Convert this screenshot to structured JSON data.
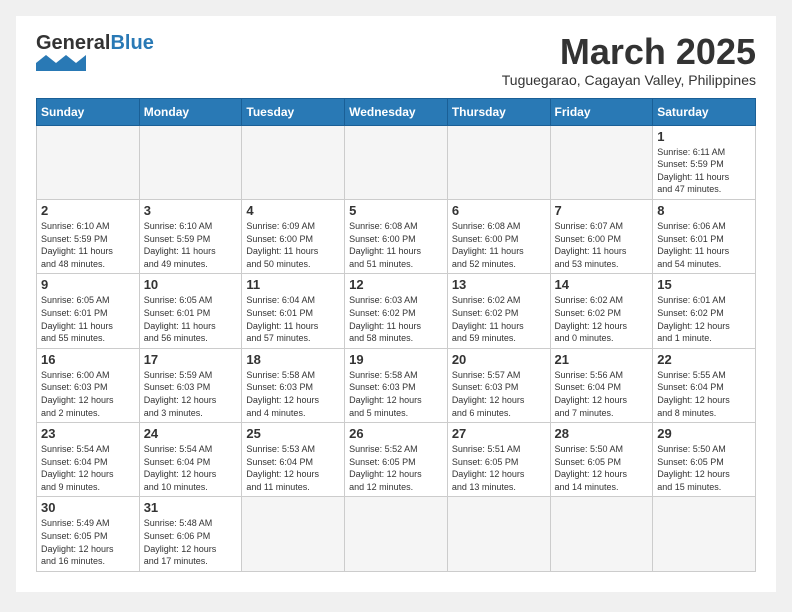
{
  "header": {
    "logo_general": "General",
    "logo_blue": "Blue",
    "month_title": "March 2025",
    "location": "Tuguegarao, Cagayan Valley, Philippines"
  },
  "weekdays": [
    "Sunday",
    "Monday",
    "Tuesday",
    "Wednesday",
    "Thursday",
    "Friday",
    "Saturday"
  ],
  "weeks": [
    [
      {
        "day": "",
        "info": ""
      },
      {
        "day": "",
        "info": ""
      },
      {
        "day": "",
        "info": ""
      },
      {
        "day": "",
        "info": ""
      },
      {
        "day": "",
        "info": ""
      },
      {
        "day": "",
        "info": ""
      },
      {
        "day": "1",
        "info": "Sunrise: 6:11 AM\nSunset: 5:59 PM\nDaylight: 11 hours\nand 47 minutes."
      }
    ],
    [
      {
        "day": "2",
        "info": "Sunrise: 6:10 AM\nSunset: 5:59 PM\nDaylight: 11 hours\nand 48 minutes."
      },
      {
        "day": "3",
        "info": "Sunrise: 6:10 AM\nSunset: 5:59 PM\nDaylight: 11 hours\nand 49 minutes."
      },
      {
        "day": "4",
        "info": "Sunrise: 6:09 AM\nSunset: 6:00 PM\nDaylight: 11 hours\nand 50 minutes."
      },
      {
        "day": "5",
        "info": "Sunrise: 6:08 AM\nSunset: 6:00 PM\nDaylight: 11 hours\nand 51 minutes."
      },
      {
        "day": "6",
        "info": "Sunrise: 6:08 AM\nSunset: 6:00 PM\nDaylight: 11 hours\nand 52 minutes."
      },
      {
        "day": "7",
        "info": "Sunrise: 6:07 AM\nSunset: 6:00 PM\nDaylight: 11 hours\nand 53 minutes."
      },
      {
        "day": "8",
        "info": "Sunrise: 6:06 AM\nSunset: 6:01 PM\nDaylight: 11 hours\nand 54 minutes."
      }
    ],
    [
      {
        "day": "9",
        "info": "Sunrise: 6:05 AM\nSunset: 6:01 PM\nDaylight: 11 hours\nand 55 minutes."
      },
      {
        "day": "10",
        "info": "Sunrise: 6:05 AM\nSunset: 6:01 PM\nDaylight: 11 hours\nand 56 minutes."
      },
      {
        "day": "11",
        "info": "Sunrise: 6:04 AM\nSunset: 6:01 PM\nDaylight: 11 hours\nand 57 minutes."
      },
      {
        "day": "12",
        "info": "Sunrise: 6:03 AM\nSunset: 6:02 PM\nDaylight: 11 hours\nand 58 minutes."
      },
      {
        "day": "13",
        "info": "Sunrise: 6:02 AM\nSunset: 6:02 PM\nDaylight: 11 hours\nand 59 minutes."
      },
      {
        "day": "14",
        "info": "Sunrise: 6:02 AM\nSunset: 6:02 PM\nDaylight: 12 hours\nand 0 minutes."
      },
      {
        "day": "15",
        "info": "Sunrise: 6:01 AM\nSunset: 6:02 PM\nDaylight: 12 hours\nand 1 minute."
      }
    ],
    [
      {
        "day": "16",
        "info": "Sunrise: 6:00 AM\nSunset: 6:03 PM\nDaylight: 12 hours\nand 2 minutes."
      },
      {
        "day": "17",
        "info": "Sunrise: 5:59 AM\nSunset: 6:03 PM\nDaylight: 12 hours\nand 3 minutes."
      },
      {
        "day": "18",
        "info": "Sunrise: 5:58 AM\nSunset: 6:03 PM\nDaylight: 12 hours\nand 4 minutes."
      },
      {
        "day": "19",
        "info": "Sunrise: 5:58 AM\nSunset: 6:03 PM\nDaylight: 12 hours\nand 5 minutes."
      },
      {
        "day": "20",
        "info": "Sunrise: 5:57 AM\nSunset: 6:03 PM\nDaylight: 12 hours\nand 6 minutes."
      },
      {
        "day": "21",
        "info": "Sunrise: 5:56 AM\nSunset: 6:04 PM\nDaylight: 12 hours\nand 7 minutes."
      },
      {
        "day": "22",
        "info": "Sunrise: 5:55 AM\nSunset: 6:04 PM\nDaylight: 12 hours\nand 8 minutes."
      }
    ],
    [
      {
        "day": "23",
        "info": "Sunrise: 5:54 AM\nSunset: 6:04 PM\nDaylight: 12 hours\nand 9 minutes."
      },
      {
        "day": "24",
        "info": "Sunrise: 5:54 AM\nSunset: 6:04 PM\nDaylight: 12 hours\nand 10 minutes."
      },
      {
        "day": "25",
        "info": "Sunrise: 5:53 AM\nSunset: 6:04 PM\nDaylight: 12 hours\nand 11 minutes."
      },
      {
        "day": "26",
        "info": "Sunrise: 5:52 AM\nSunset: 6:05 PM\nDaylight: 12 hours\nand 12 minutes."
      },
      {
        "day": "27",
        "info": "Sunrise: 5:51 AM\nSunset: 6:05 PM\nDaylight: 12 hours\nand 13 minutes."
      },
      {
        "day": "28",
        "info": "Sunrise: 5:50 AM\nSunset: 6:05 PM\nDaylight: 12 hours\nand 14 minutes."
      },
      {
        "day": "29",
        "info": "Sunrise: 5:50 AM\nSunset: 6:05 PM\nDaylight: 12 hours\nand 15 minutes."
      }
    ],
    [
      {
        "day": "30",
        "info": "Sunrise: 5:49 AM\nSunset: 6:05 PM\nDaylight: 12 hours\nand 16 minutes."
      },
      {
        "day": "31",
        "info": "Sunrise: 5:48 AM\nSunset: 6:06 PM\nDaylight: 12 hours\nand 17 minutes."
      },
      {
        "day": "",
        "info": ""
      },
      {
        "day": "",
        "info": ""
      },
      {
        "day": "",
        "info": ""
      },
      {
        "day": "",
        "info": ""
      },
      {
        "day": "",
        "info": ""
      }
    ]
  ]
}
